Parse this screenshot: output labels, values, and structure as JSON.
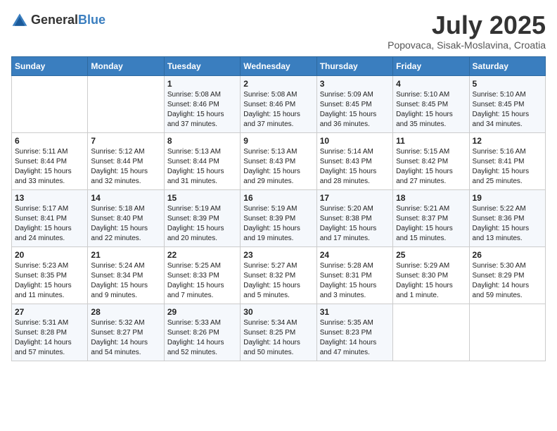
{
  "header": {
    "logo_general": "General",
    "logo_blue": "Blue",
    "month_title": "July 2025",
    "location": "Popovaca, Sisak-Moslavina, Croatia"
  },
  "days_of_week": [
    "Sunday",
    "Monday",
    "Tuesday",
    "Wednesday",
    "Thursday",
    "Friday",
    "Saturday"
  ],
  "weeks": [
    [
      {
        "day": "",
        "content": ""
      },
      {
        "day": "",
        "content": ""
      },
      {
        "day": "1",
        "content": "Sunrise: 5:08 AM\nSunset: 8:46 PM\nDaylight: 15 hours and 37 minutes."
      },
      {
        "day": "2",
        "content": "Sunrise: 5:08 AM\nSunset: 8:46 PM\nDaylight: 15 hours and 37 minutes."
      },
      {
        "day": "3",
        "content": "Sunrise: 5:09 AM\nSunset: 8:45 PM\nDaylight: 15 hours and 36 minutes."
      },
      {
        "day": "4",
        "content": "Sunrise: 5:10 AM\nSunset: 8:45 PM\nDaylight: 15 hours and 35 minutes."
      },
      {
        "day": "5",
        "content": "Sunrise: 5:10 AM\nSunset: 8:45 PM\nDaylight: 15 hours and 34 minutes."
      }
    ],
    [
      {
        "day": "6",
        "content": "Sunrise: 5:11 AM\nSunset: 8:44 PM\nDaylight: 15 hours and 33 minutes."
      },
      {
        "day": "7",
        "content": "Sunrise: 5:12 AM\nSunset: 8:44 PM\nDaylight: 15 hours and 32 minutes."
      },
      {
        "day": "8",
        "content": "Sunrise: 5:13 AM\nSunset: 8:44 PM\nDaylight: 15 hours and 31 minutes."
      },
      {
        "day": "9",
        "content": "Sunrise: 5:13 AM\nSunset: 8:43 PM\nDaylight: 15 hours and 29 minutes."
      },
      {
        "day": "10",
        "content": "Sunrise: 5:14 AM\nSunset: 8:43 PM\nDaylight: 15 hours and 28 minutes."
      },
      {
        "day": "11",
        "content": "Sunrise: 5:15 AM\nSunset: 8:42 PM\nDaylight: 15 hours and 27 minutes."
      },
      {
        "day": "12",
        "content": "Sunrise: 5:16 AM\nSunset: 8:41 PM\nDaylight: 15 hours and 25 minutes."
      }
    ],
    [
      {
        "day": "13",
        "content": "Sunrise: 5:17 AM\nSunset: 8:41 PM\nDaylight: 15 hours and 24 minutes."
      },
      {
        "day": "14",
        "content": "Sunrise: 5:18 AM\nSunset: 8:40 PM\nDaylight: 15 hours and 22 minutes."
      },
      {
        "day": "15",
        "content": "Sunrise: 5:19 AM\nSunset: 8:39 PM\nDaylight: 15 hours and 20 minutes."
      },
      {
        "day": "16",
        "content": "Sunrise: 5:19 AM\nSunset: 8:39 PM\nDaylight: 15 hours and 19 minutes."
      },
      {
        "day": "17",
        "content": "Sunrise: 5:20 AM\nSunset: 8:38 PM\nDaylight: 15 hours and 17 minutes."
      },
      {
        "day": "18",
        "content": "Sunrise: 5:21 AM\nSunset: 8:37 PM\nDaylight: 15 hours and 15 minutes."
      },
      {
        "day": "19",
        "content": "Sunrise: 5:22 AM\nSunset: 8:36 PM\nDaylight: 15 hours and 13 minutes."
      }
    ],
    [
      {
        "day": "20",
        "content": "Sunrise: 5:23 AM\nSunset: 8:35 PM\nDaylight: 15 hours and 11 minutes."
      },
      {
        "day": "21",
        "content": "Sunrise: 5:24 AM\nSunset: 8:34 PM\nDaylight: 15 hours and 9 minutes."
      },
      {
        "day": "22",
        "content": "Sunrise: 5:25 AM\nSunset: 8:33 PM\nDaylight: 15 hours and 7 minutes."
      },
      {
        "day": "23",
        "content": "Sunrise: 5:27 AM\nSunset: 8:32 PM\nDaylight: 15 hours and 5 minutes."
      },
      {
        "day": "24",
        "content": "Sunrise: 5:28 AM\nSunset: 8:31 PM\nDaylight: 15 hours and 3 minutes."
      },
      {
        "day": "25",
        "content": "Sunrise: 5:29 AM\nSunset: 8:30 PM\nDaylight: 15 hours and 1 minute."
      },
      {
        "day": "26",
        "content": "Sunrise: 5:30 AM\nSunset: 8:29 PM\nDaylight: 14 hours and 59 minutes."
      }
    ],
    [
      {
        "day": "27",
        "content": "Sunrise: 5:31 AM\nSunset: 8:28 PM\nDaylight: 14 hours and 57 minutes."
      },
      {
        "day": "28",
        "content": "Sunrise: 5:32 AM\nSunset: 8:27 PM\nDaylight: 14 hours and 54 minutes."
      },
      {
        "day": "29",
        "content": "Sunrise: 5:33 AM\nSunset: 8:26 PM\nDaylight: 14 hours and 52 minutes."
      },
      {
        "day": "30",
        "content": "Sunrise: 5:34 AM\nSunset: 8:25 PM\nDaylight: 14 hours and 50 minutes."
      },
      {
        "day": "31",
        "content": "Sunrise: 5:35 AM\nSunset: 8:23 PM\nDaylight: 14 hours and 47 minutes."
      },
      {
        "day": "",
        "content": ""
      },
      {
        "day": "",
        "content": ""
      }
    ]
  ]
}
